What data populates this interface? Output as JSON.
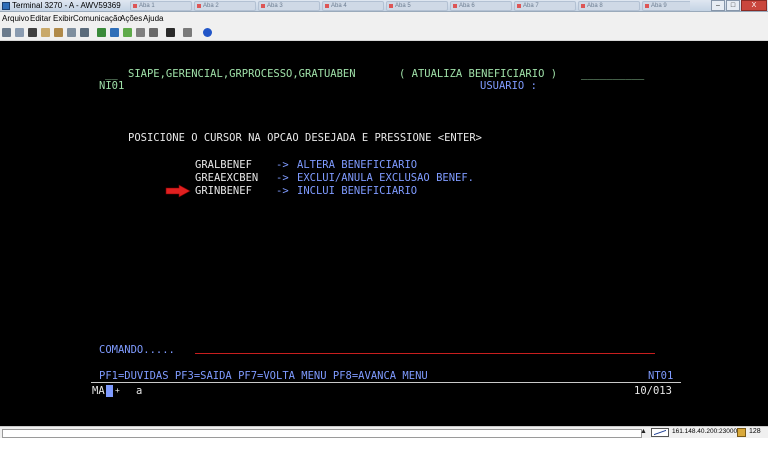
{
  "window": {
    "title": "Terminal 3270 - A - AWV59369",
    "background_tabs": [
      "Aba 1",
      "Aba 2",
      "Aba 3",
      "Aba 4",
      "Aba 5",
      "Aba 6",
      "Aba 7",
      "Aba 8",
      "Aba 9"
    ],
    "buttons": {
      "minimize": "–",
      "maximize": "□",
      "close": "X"
    }
  },
  "menu": {
    "items": [
      "Arquivo",
      "Editar",
      "Exibir",
      "Comunicação",
      "Ações",
      "Ajuda"
    ]
  },
  "toolbar": {
    "icons": [
      "print-icon",
      "copy-icon",
      "cut-icon",
      "paste-icon",
      "paste-special-icon",
      "select-all-icon",
      "macro-icon",
      "record-icon",
      "stop-icon",
      "play-icon",
      "settings-icon",
      "keyboard-icon",
      "send-icon",
      "receive-icon",
      "help-icon"
    ]
  },
  "terminal": {
    "header_prefix": "__",
    "header_path": "SIAPE,GERENCIAL,GRPROCESSO,GRATUABEN",
    "header_title": "( ATUALIZA BENEFICIARIO )",
    "header_underline": "__________",
    "screen_id": "NI01",
    "usuario_label": "USUARIO :",
    "instruction": "POSICIONE O CURSOR NA OPCAO DESEJADA E PRESSIONE <ENTER>",
    "options": [
      {
        "code": "GRALBENEF",
        "arrow": "->",
        "description": "ALTERA BENEFICIARIO"
      },
      {
        "code": "GREAEXCBEN",
        "arrow": "->",
        "description": "EXCLUI/ANULA EXCLUSAO BENEF."
      },
      {
        "code": "GRINBENEF",
        "arrow": "->",
        "description": "INCLUI BENEFICIARIO"
      }
    ],
    "comando_label": "COMANDO.....",
    "pf_keys": "PF1=DUVIDAS PF3=SAIDA PF7=VOLTA MENU PF8=AVANCA MENU",
    "terminal_id": "NT01",
    "oia_left": "MA",
    "oia_plus": "+",
    "oia_a": "a",
    "cursor_position": "10/013"
  },
  "statusbar": {
    "host": "161.148.40.200:23000",
    "count": "128"
  },
  "colors": {
    "terminal_bg": "#000000",
    "field_text": "#9fe0a8",
    "protected_text": "#e8e8e8",
    "input_text": "#7f9bff",
    "input_line": "#c81e1e",
    "pointer_arrow": "#e02020"
  }
}
